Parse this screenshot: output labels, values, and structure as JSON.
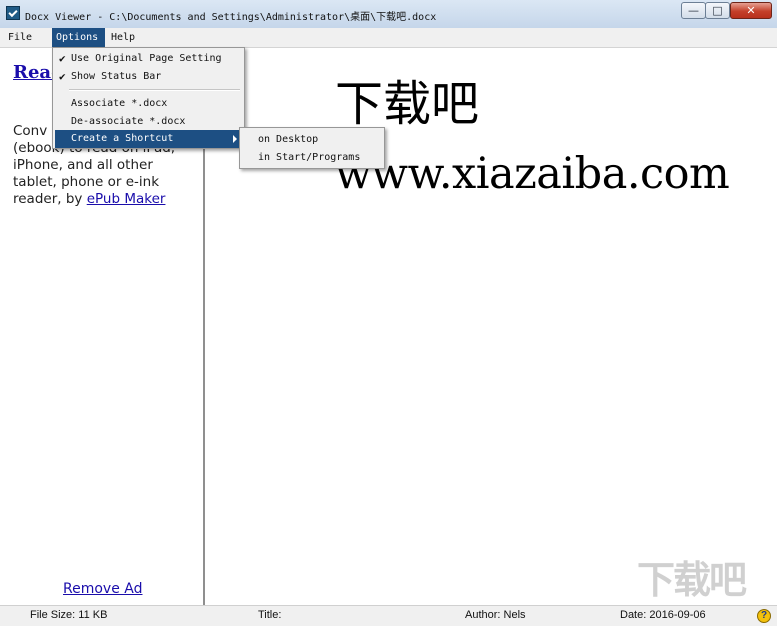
{
  "window": {
    "title": "Docx Viewer - C:\\Documents and Settings\\Administrator\\桌面\\下载吧.docx",
    "minimize_glyph": "—",
    "maximize_glyph": "□",
    "close_glyph": "✕"
  },
  "menubar": {
    "file": "File",
    "options": "Options",
    "help": "Help"
  },
  "options_menu": {
    "items": [
      {
        "label": "Use Original Page Setting",
        "checked": true
      },
      {
        "label": "Show Status Bar",
        "checked": true
      },
      {
        "label": "Associate *.docx",
        "checked": false
      },
      {
        "label": "De-associate *.docx",
        "checked": false
      },
      {
        "label": "Create a Shortcut",
        "checked": false,
        "has_submenu": true
      }
    ],
    "check_glyph": "✔"
  },
  "shortcut_submenu": {
    "items": [
      "on Desktop",
      "in Start/Programs"
    ]
  },
  "left_pane": {
    "promo_title": "Read iPad",
    "promo_text_visible": "Conv document to ePub (ebook) to read on iPad, iPhone, and all other tablet, phone or e-ink reader, by ",
    "promo_link": "ePub Maker",
    "remove_ad": "Remove Ad"
  },
  "document": {
    "line1": "下载吧",
    "line2": "www.xiazaiba.com"
  },
  "statusbar": {
    "file_size": "File Size: 11 KB",
    "title": "Title:",
    "author": "Author: Nels",
    "date": "Date: 2016-09-06",
    "help_glyph": "?"
  },
  "watermark": "下载吧",
  "colors": {
    "menu_highlight": "#1d4f83",
    "link": "#1a0dab",
    "close_button": "#c4402a"
  }
}
